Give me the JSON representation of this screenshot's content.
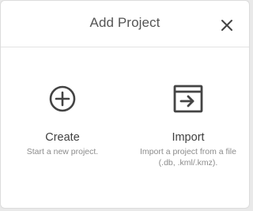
{
  "dialog": {
    "title": "Add Project",
    "close_icon": "close-icon"
  },
  "options": {
    "create": {
      "icon": "plus-circle-icon",
      "label": "Create",
      "description": "Start a new project."
    },
    "import": {
      "icon": "import-icon",
      "label": "Import",
      "description": "Import a project from a file (.db, .kml/.kmz)."
    }
  },
  "colors": {
    "icon": "#444444",
    "title": "#555555",
    "label": "#404040",
    "description": "#8c8c8c"
  }
}
